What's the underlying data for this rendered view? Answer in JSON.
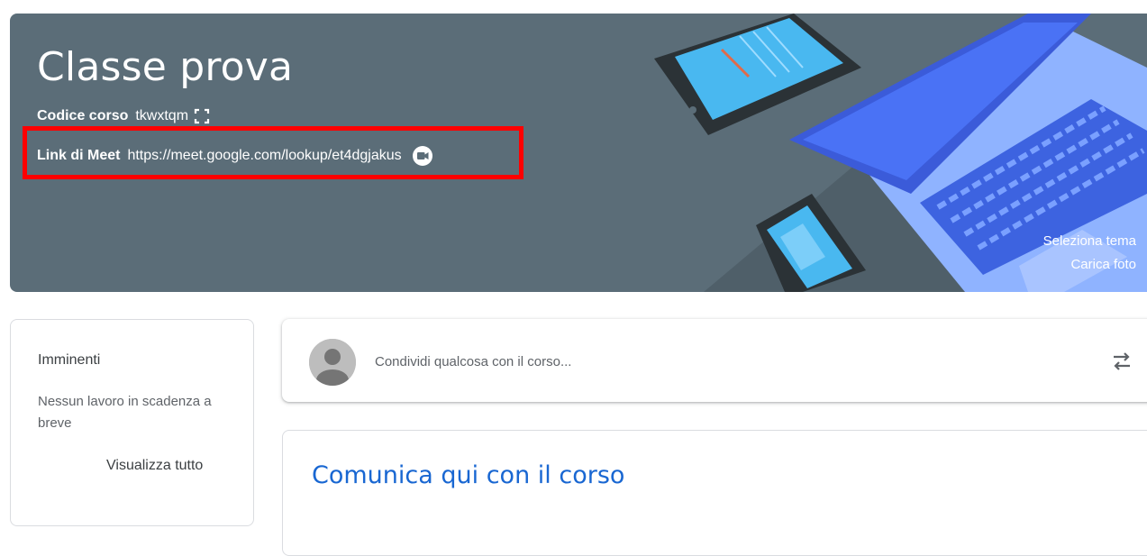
{
  "banner": {
    "title": "Classe prova",
    "code_label": "Codice corso",
    "code_value": "tkwxtqm",
    "meet_label": "Link di Meet",
    "meet_url": "https://meet.google.com/lookup/et4dgjakus",
    "select_theme": "Seleziona tema",
    "upload_photo": "Carica foto",
    "background_color": "#5b6d78"
  },
  "upcoming": {
    "title": "Imminenti",
    "empty_text": "Nessun lavoro in scadenza a breve",
    "view_all": "Visualizza tutto"
  },
  "stream": {
    "share_placeholder": "Condividi qualcosa con il corso...",
    "communicate_title": "Comunica qui con il corso",
    "accent_color": "#1967d2"
  },
  "annotation": {
    "highlight_color": "#ff0000"
  }
}
